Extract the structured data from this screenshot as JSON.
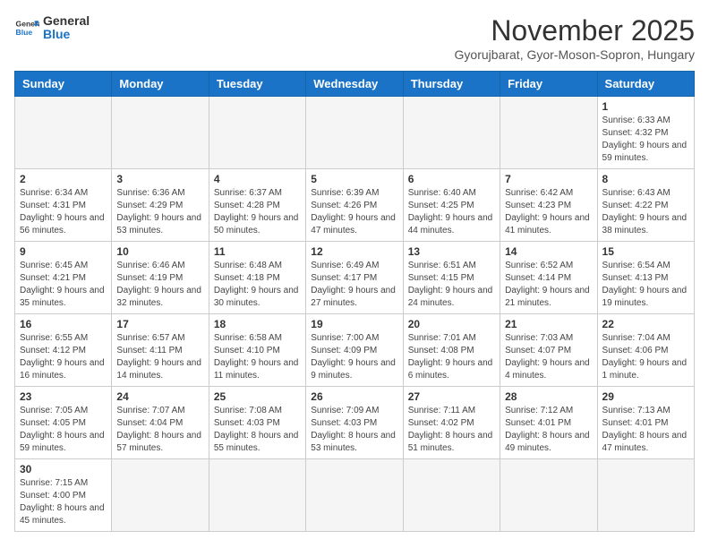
{
  "header": {
    "logo_line1": "General",
    "logo_line2": "Blue",
    "month_title": "November 2025",
    "subtitle": "Gyorujbarat, Gyor-Moson-Sopron, Hungary"
  },
  "weekdays": [
    "Sunday",
    "Monday",
    "Tuesday",
    "Wednesday",
    "Thursday",
    "Friday",
    "Saturday"
  ],
  "weeks": [
    [
      {
        "day": "",
        "info": ""
      },
      {
        "day": "",
        "info": ""
      },
      {
        "day": "",
        "info": ""
      },
      {
        "day": "",
        "info": ""
      },
      {
        "day": "",
        "info": ""
      },
      {
        "day": "",
        "info": ""
      },
      {
        "day": "1",
        "info": "Sunrise: 6:33 AM\nSunset: 4:32 PM\nDaylight: 9 hours and 59 minutes."
      }
    ],
    [
      {
        "day": "2",
        "info": "Sunrise: 6:34 AM\nSunset: 4:31 PM\nDaylight: 9 hours and 56 minutes."
      },
      {
        "day": "3",
        "info": "Sunrise: 6:36 AM\nSunset: 4:29 PM\nDaylight: 9 hours and 53 minutes."
      },
      {
        "day": "4",
        "info": "Sunrise: 6:37 AM\nSunset: 4:28 PM\nDaylight: 9 hours and 50 minutes."
      },
      {
        "day": "5",
        "info": "Sunrise: 6:39 AM\nSunset: 4:26 PM\nDaylight: 9 hours and 47 minutes."
      },
      {
        "day": "6",
        "info": "Sunrise: 6:40 AM\nSunset: 4:25 PM\nDaylight: 9 hours and 44 minutes."
      },
      {
        "day": "7",
        "info": "Sunrise: 6:42 AM\nSunset: 4:23 PM\nDaylight: 9 hours and 41 minutes."
      },
      {
        "day": "8",
        "info": "Sunrise: 6:43 AM\nSunset: 4:22 PM\nDaylight: 9 hours and 38 minutes."
      }
    ],
    [
      {
        "day": "9",
        "info": "Sunrise: 6:45 AM\nSunset: 4:21 PM\nDaylight: 9 hours and 35 minutes."
      },
      {
        "day": "10",
        "info": "Sunrise: 6:46 AM\nSunset: 4:19 PM\nDaylight: 9 hours and 32 minutes."
      },
      {
        "day": "11",
        "info": "Sunrise: 6:48 AM\nSunset: 4:18 PM\nDaylight: 9 hours and 30 minutes."
      },
      {
        "day": "12",
        "info": "Sunrise: 6:49 AM\nSunset: 4:17 PM\nDaylight: 9 hours and 27 minutes."
      },
      {
        "day": "13",
        "info": "Sunrise: 6:51 AM\nSunset: 4:15 PM\nDaylight: 9 hours and 24 minutes."
      },
      {
        "day": "14",
        "info": "Sunrise: 6:52 AM\nSunset: 4:14 PM\nDaylight: 9 hours and 21 minutes."
      },
      {
        "day": "15",
        "info": "Sunrise: 6:54 AM\nSunset: 4:13 PM\nDaylight: 9 hours and 19 minutes."
      }
    ],
    [
      {
        "day": "16",
        "info": "Sunrise: 6:55 AM\nSunset: 4:12 PM\nDaylight: 9 hours and 16 minutes."
      },
      {
        "day": "17",
        "info": "Sunrise: 6:57 AM\nSunset: 4:11 PM\nDaylight: 9 hours and 14 minutes."
      },
      {
        "day": "18",
        "info": "Sunrise: 6:58 AM\nSunset: 4:10 PM\nDaylight: 9 hours and 11 minutes."
      },
      {
        "day": "19",
        "info": "Sunrise: 7:00 AM\nSunset: 4:09 PM\nDaylight: 9 hours and 9 minutes."
      },
      {
        "day": "20",
        "info": "Sunrise: 7:01 AM\nSunset: 4:08 PM\nDaylight: 9 hours and 6 minutes."
      },
      {
        "day": "21",
        "info": "Sunrise: 7:03 AM\nSunset: 4:07 PM\nDaylight: 9 hours and 4 minutes."
      },
      {
        "day": "22",
        "info": "Sunrise: 7:04 AM\nSunset: 4:06 PM\nDaylight: 9 hours and 1 minute."
      }
    ],
    [
      {
        "day": "23",
        "info": "Sunrise: 7:05 AM\nSunset: 4:05 PM\nDaylight: 8 hours and 59 minutes."
      },
      {
        "day": "24",
        "info": "Sunrise: 7:07 AM\nSunset: 4:04 PM\nDaylight: 8 hours and 57 minutes."
      },
      {
        "day": "25",
        "info": "Sunrise: 7:08 AM\nSunset: 4:03 PM\nDaylight: 8 hours and 55 minutes."
      },
      {
        "day": "26",
        "info": "Sunrise: 7:09 AM\nSunset: 4:03 PM\nDaylight: 8 hours and 53 minutes."
      },
      {
        "day": "27",
        "info": "Sunrise: 7:11 AM\nSunset: 4:02 PM\nDaylight: 8 hours and 51 minutes."
      },
      {
        "day": "28",
        "info": "Sunrise: 7:12 AM\nSunset: 4:01 PM\nDaylight: 8 hours and 49 minutes."
      },
      {
        "day": "29",
        "info": "Sunrise: 7:13 AM\nSunset: 4:01 PM\nDaylight: 8 hours and 47 minutes."
      }
    ],
    [
      {
        "day": "30",
        "info": "Sunrise: 7:15 AM\nSunset: 4:00 PM\nDaylight: 8 hours and 45 minutes."
      },
      {
        "day": "",
        "info": ""
      },
      {
        "day": "",
        "info": ""
      },
      {
        "day": "",
        "info": ""
      },
      {
        "day": "",
        "info": ""
      },
      {
        "day": "",
        "info": ""
      },
      {
        "day": "",
        "info": ""
      }
    ]
  ]
}
